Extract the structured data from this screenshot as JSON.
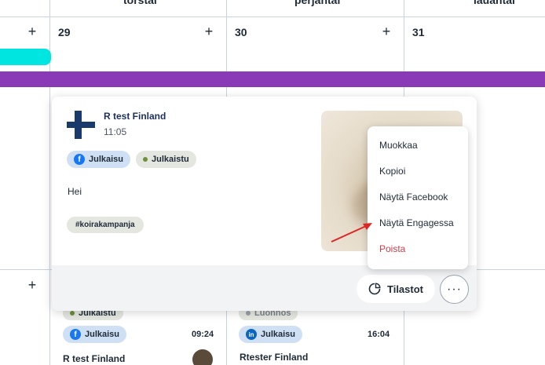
{
  "calendar": {
    "day_names": [
      "torstai",
      "perjantai",
      "lauantai"
    ],
    "day_numbers": [
      "29",
      "30",
      "31"
    ],
    "add_label": "+"
  },
  "post": {
    "account_name": "R test Finland",
    "time": "11:05",
    "channel_label": "Julkaisu",
    "status_label": "Julkaistu",
    "text": "Hei",
    "hashtag": "#koirakampanja",
    "stats_label": "Tilastot",
    "more_label": "···"
  },
  "menu": {
    "items": [
      "Muokkaa",
      "Kopioi",
      "Näytä Facebook",
      "Näytä Engagessa",
      "Poista"
    ]
  },
  "background_posts": [
    {
      "status": "Julkaistu",
      "channel_label": "Julkaisu",
      "time": "09:24",
      "account": "R test Finland"
    },
    {
      "status": "Luonnos",
      "channel_label": "Julkaisu",
      "time": "16:04",
      "account": "Rtester Finland"
    }
  ],
  "colors": {
    "accent_purple": "#8a3ab6",
    "accent_cyan": "#00e5e0",
    "danger": "#d03b4a",
    "facebook": "#1877f2",
    "linkedin": "#0a66c2",
    "status_published": "#6b8f3a"
  }
}
